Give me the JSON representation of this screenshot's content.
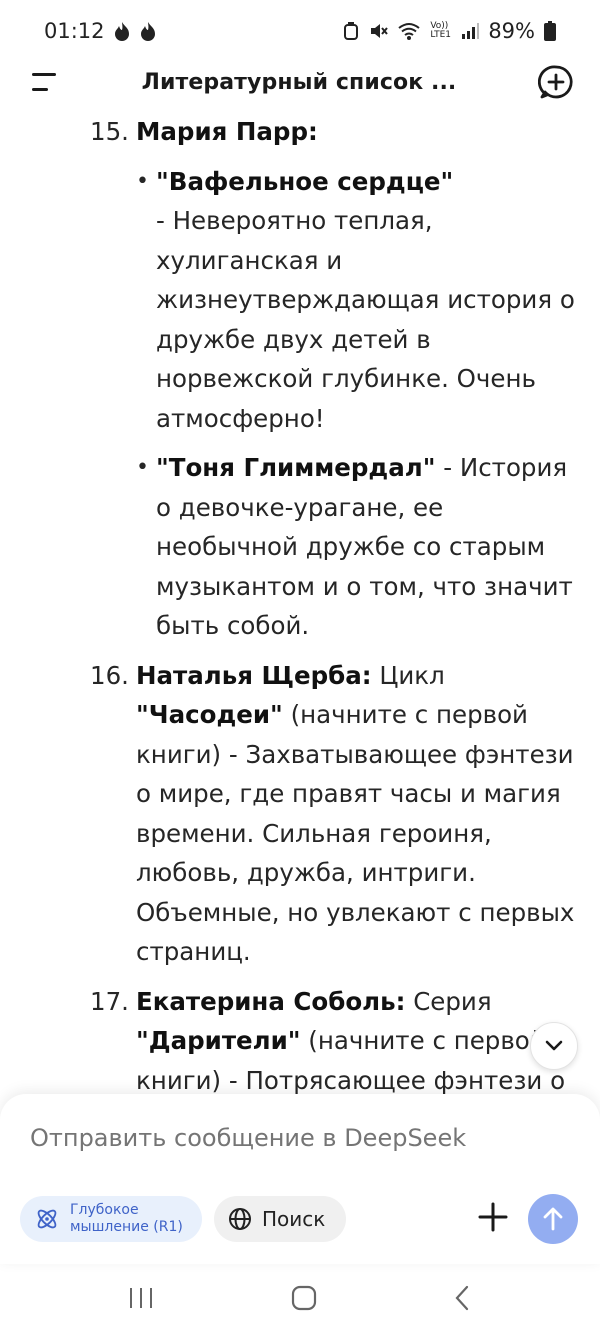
{
  "status": {
    "time": "01:12",
    "battery": "89%",
    "network_label": "Vo)) LTE1"
  },
  "header": {
    "title": "Литературный список ..."
  },
  "content": {
    "items": [
      {
        "number": "15.",
        "author": "Мария Парр:",
        "rest": "",
        "subitems": [
          {
            "title": "\"Вафельное сердце\"",
            "text": "- Невероятно теплая, хулиганская и жизнеутверждающая история о дружбе двух детей в норвежской глубинке. Очень атмосферно!"
          },
          {
            "title": "\"Тоня Глиммердал\"",
            "text": " - История о девочке-урагане, ее необычной дружбе со старым музыкантом и о том, что значит быть собой."
          }
        ]
      },
      {
        "number": "16.",
        "author": "Наталья Щерба:",
        "pre": " Цикл ",
        "series": "\"Часодеи\"",
        "rest": " (начните с первой книги) - Захватывающее фэнтези о мире, где правят часы и магия времени. Сильная героиня, любовь, дружба, интриги. Объемные, но увлекают с первых страниц."
      },
      {
        "number": "17.",
        "author": "Екатерина Соболь:",
        "pre": " Серия ",
        "series": "\"Дарители\"",
        "rest": " (начните с первой книги) - Потрясающее фэнтези о магии подарков (дарениях)"
      }
    ]
  },
  "composer": {
    "placeholder": "Отправить сообщение в DeepSeek",
    "deep_think_label": "Глубокое мышление (R1)",
    "search_label": "Поиск"
  },
  "colors": {
    "accent": "#3f63c8",
    "send_button": "#93adf1",
    "chip_bg": "#e8f0fc"
  }
}
